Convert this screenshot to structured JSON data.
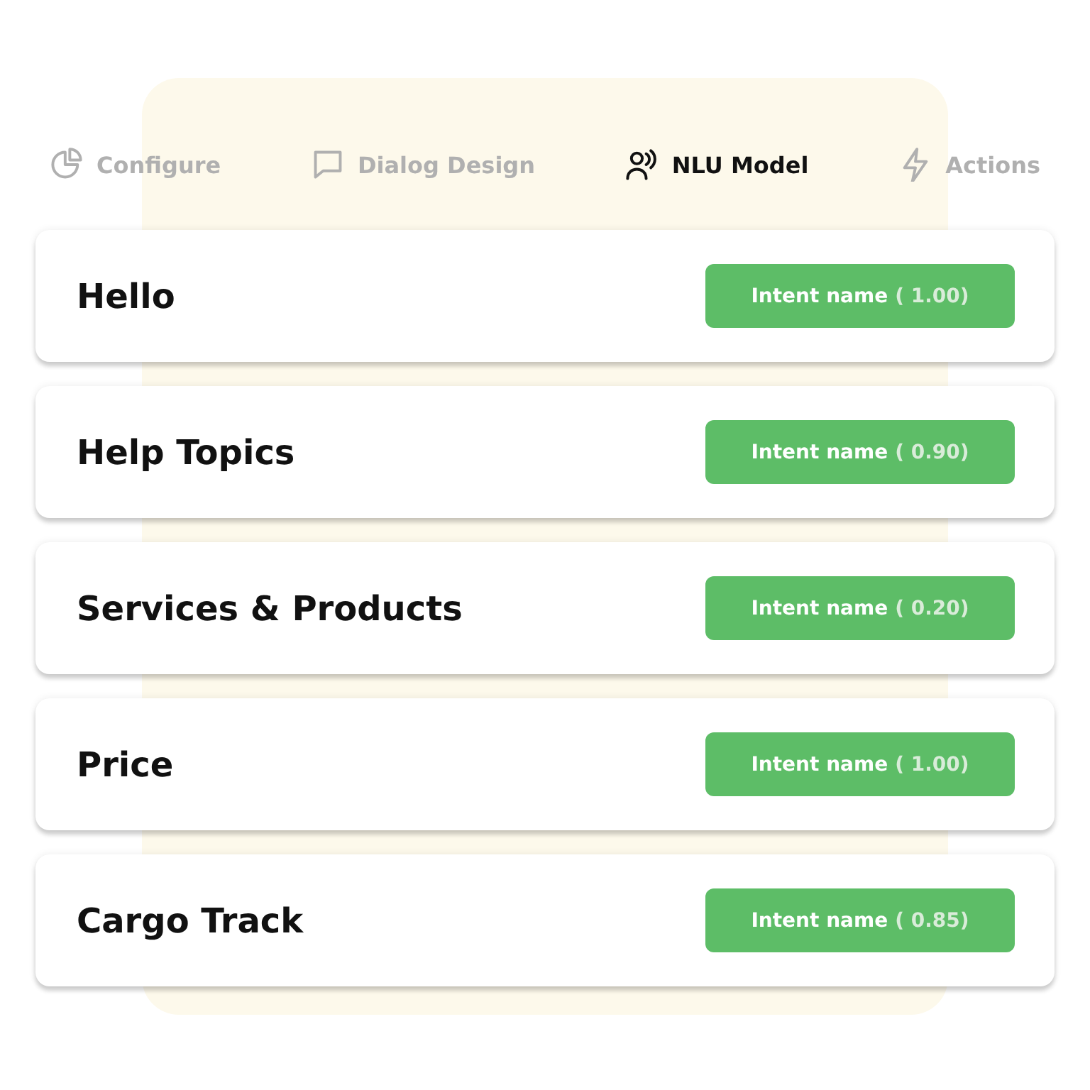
{
  "tabs": [
    {
      "label": "Configure",
      "selected": false
    },
    {
      "label": "Dialog Design",
      "selected": false
    },
    {
      "label": "NLU Model",
      "selected": true
    },
    {
      "label": "Actions",
      "selected": false
    }
  ],
  "intents": [
    {
      "title": "Hello",
      "badge": "Intent name",
      "score": "( 1.00)"
    },
    {
      "title": "Help Topics",
      "badge": "Intent name",
      "score": "( 0.90)"
    },
    {
      "title": "Services & Products",
      "badge": "Intent name",
      "score": "( 0.20)"
    },
    {
      "title": "Price",
      "badge": "Intent name",
      "score": "( 1.00)"
    },
    {
      "title": "Cargo Track",
      "badge": "Intent name",
      "score": "( 0.85)"
    }
  ]
}
